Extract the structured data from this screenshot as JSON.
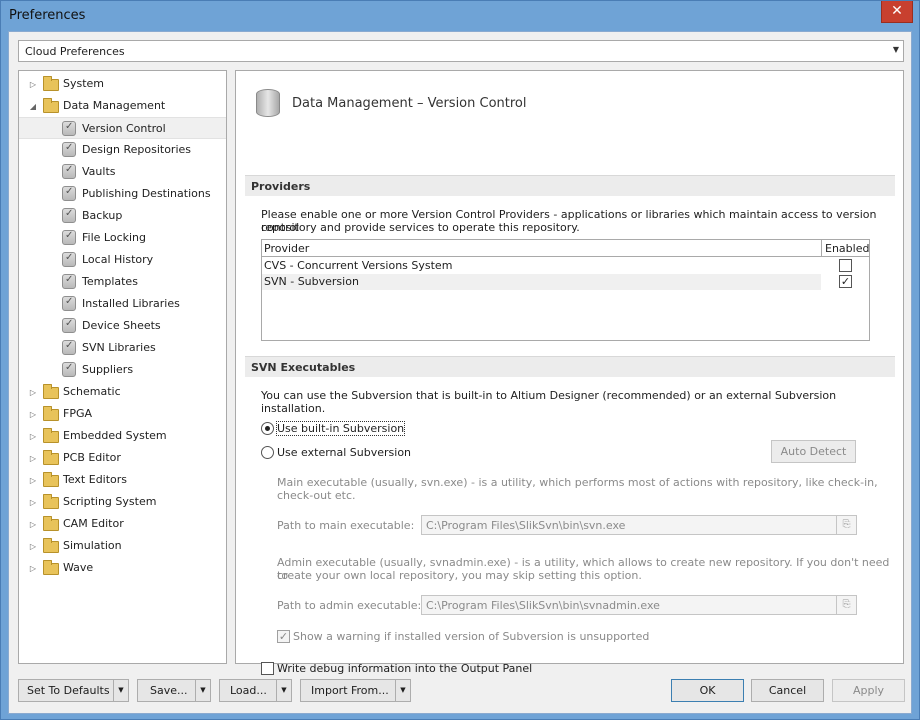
{
  "window": {
    "title": "Preferences",
    "close_glyph": "✕"
  },
  "preset_combo": {
    "value": "Cloud Preferences"
  },
  "tree": [
    {
      "label": "System",
      "level": 0,
      "expanded": false,
      "icon": "folder"
    },
    {
      "label": "Data Management",
      "level": 0,
      "expanded": true,
      "icon": "folder"
    },
    {
      "label": "Version Control",
      "level": 1,
      "icon": "db",
      "selected": true
    },
    {
      "label": "Design Repositories",
      "level": 1,
      "icon": "db"
    },
    {
      "label": "Vaults",
      "level": 1,
      "icon": "db"
    },
    {
      "label": "Publishing Destinations",
      "level": 1,
      "icon": "db"
    },
    {
      "label": "Backup",
      "level": 1,
      "icon": "db"
    },
    {
      "label": "File Locking",
      "level": 1,
      "icon": "db"
    },
    {
      "label": "Local History",
      "level": 1,
      "icon": "db"
    },
    {
      "label": "Templates",
      "level": 1,
      "icon": "db"
    },
    {
      "label": "Installed Libraries",
      "level": 1,
      "icon": "db"
    },
    {
      "label": "Device Sheets",
      "level": 1,
      "icon": "db"
    },
    {
      "label": "SVN Libraries",
      "level": 1,
      "icon": "db"
    },
    {
      "label": "Suppliers",
      "level": 1,
      "icon": "db"
    },
    {
      "label": "Schematic",
      "level": 0,
      "expanded": false,
      "icon": "folder"
    },
    {
      "label": "FPGA",
      "level": 0,
      "expanded": false,
      "icon": "folder"
    },
    {
      "label": "Embedded System",
      "level": 0,
      "expanded": false,
      "icon": "folder"
    },
    {
      "label": "PCB Editor",
      "level": 0,
      "expanded": false,
      "icon": "folder"
    },
    {
      "label": "Text Editors",
      "level": 0,
      "expanded": false,
      "icon": "folder"
    },
    {
      "label": "Scripting System",
      "level": 0,
      "expanded": false,
      "icon": "folder"
    },
    {
      "label": "CAM Editor",
      "level": 0,
      "expanded": false,
      "icon": "folder"
    },
    {
      "label": "Simulation",
      "level": 0,
      "expanded": false,
      "icon": "folder"
    },
    {
      "label": "Wave",
      "level": 0,
      "expanded": false,
      "icon": "folder"
    }
  ],
  "page": {
    "title": "Data Management – Version Control",
    "providers": {
      "heading": "Providers",
      "desc_line1": "Please enable one or more Version Control Providers - applications or libraries which maintain access to version control",
      "desc_line2": "repository and provide services to  operate this repository.",
      "col_provider": "Provider",
      "col_enabled": "Enabled",
      "rows": [
        {
          "name": "CVS - Concurrent Versions System",
          "enabled": false
        },
        {
          "name": "SVN - Subversion",
          "enabled": true
        }
      ]
    },
    "svn": {
      "heading": "SVN Executables",
      "desc": "You can use the Subversion that is built-in to Altium Designer (recommended) or an external Subversion installation.",
      "radio_builtin": "Use built-in Subversion",
      "radio_external": "Use external Subversion",
      "auto_detect": "Auto Detect",
      "main_desc_line1": "Main executable (usually, svn.exe) - is a utility, which performs most of actions with repository, like check-in,",
      "main_desc_line2": "check-out etc.",
      "main_label": "Path to main executable:",
      "main_value": "C:\\Program Files\\SlikSvn\\bin\\svn.exe",
      "admin_desc_line1": "Admin executable (usually, svnadmin.exe) - is a utility, which allows to create new repository. If you don't need to",
      "admin_desc_line2": "create your own local repository, you may skip setting this option.",
      "admin_label": "Path to admin executable:",
      "admin_value": "C:\\Program Files\\SlikSvn\\bin\\svnadmin.exe",
      "warn_label": "Show a warning if installed version of Subversion is unsupported",
      "debug_label": "Write debug information into the Output Panel"
    }
  },
  "footer": {
    "set_defaults": "Set To Defaults",
    "save": "Save...",
    "load": "Load...",
    "import_from": "Import From...",
    "ok": "OK",
    "cancel": "Cancel",
    "apply": "Apply"
  }
}
